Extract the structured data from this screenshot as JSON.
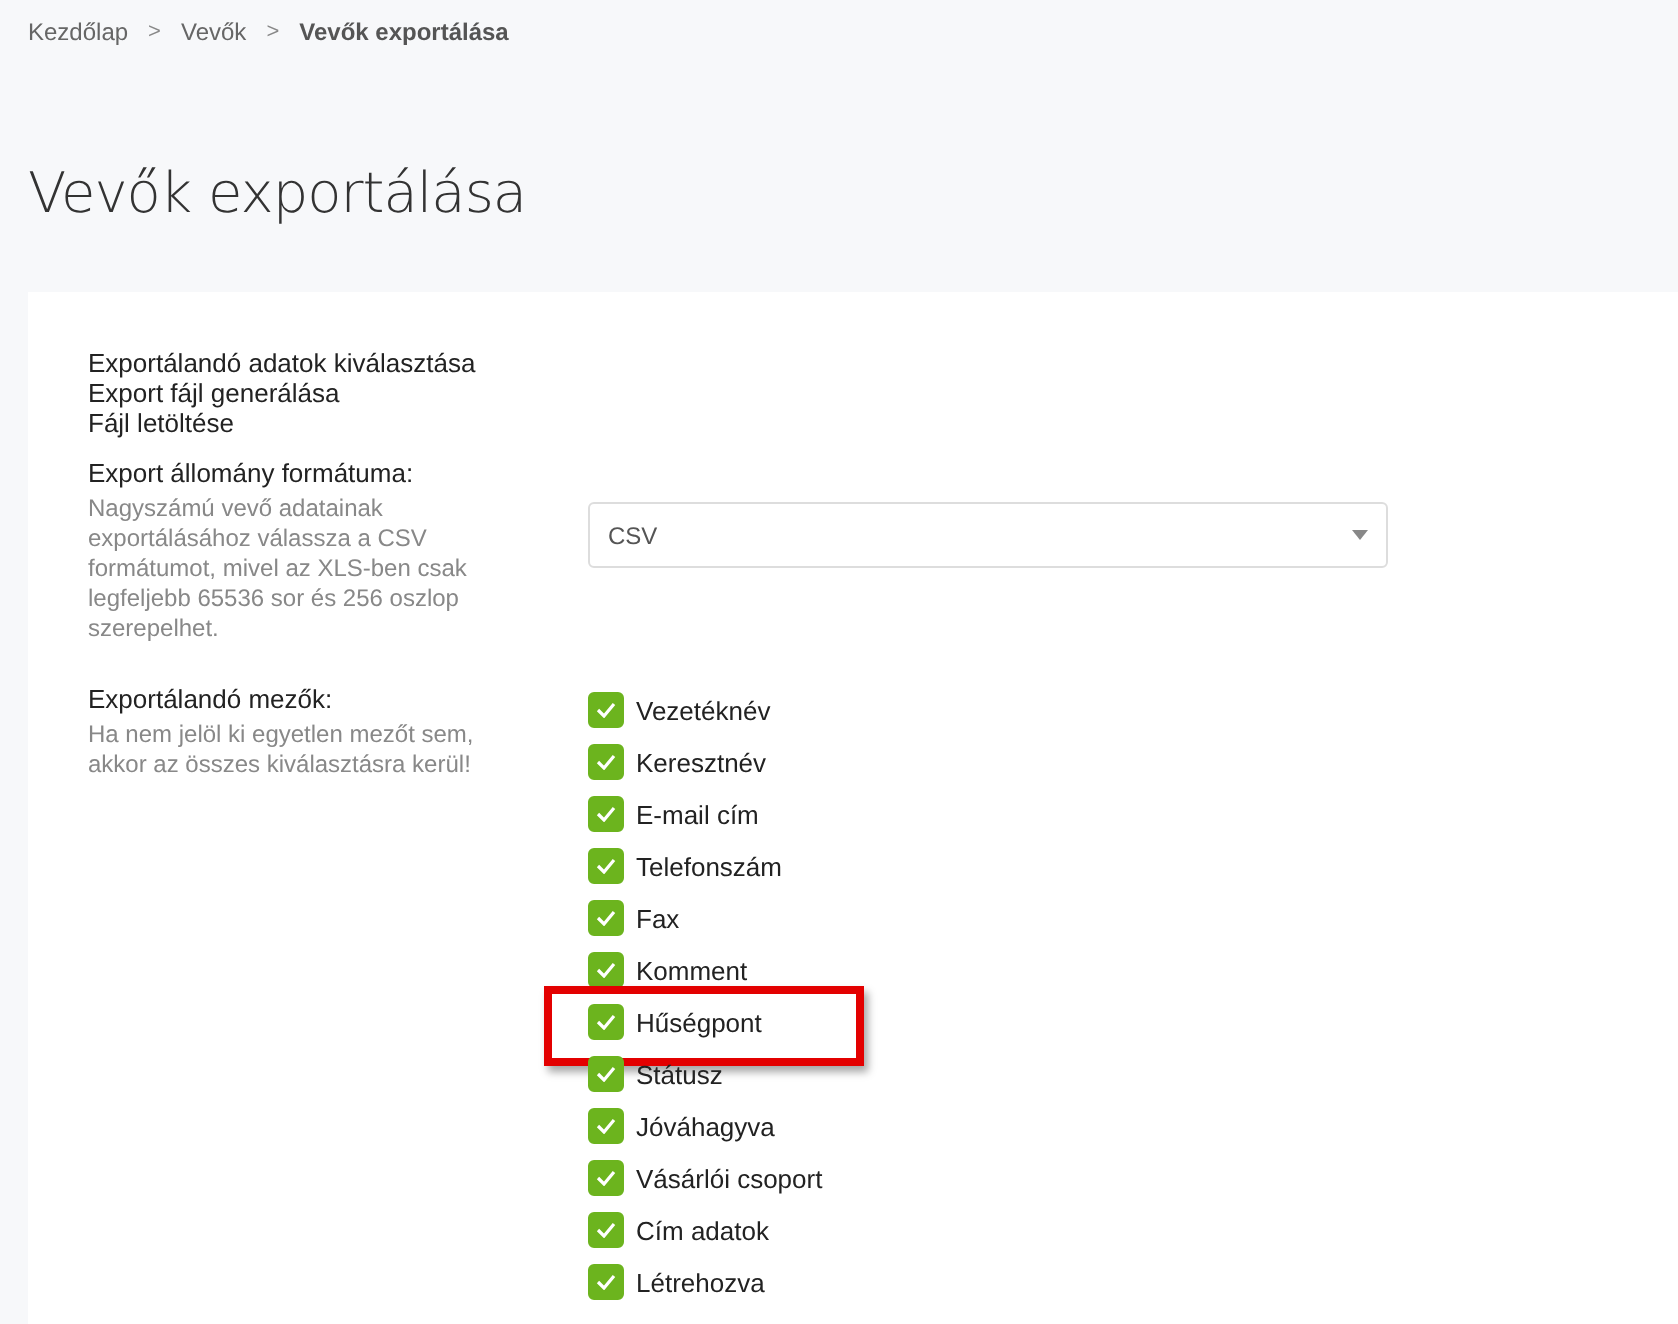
{
  "breadcrumb": [
    {
      "label": "Kezdőlap",
      "current": false
    },
    {
      "label": "Vevők",
      "current": false
    },
    {
      "label": "Vevők exportálása",
      "current": true
    }
  ],
  "breadcrumb_separator": ">",
  "title": "Vevők exportálása",
  "steps": [
    "Exportálandó adatok kiválasztása",
    "Export fájl generálása",
    "Fájl letöltése"
  ],
  "format": {
    "label": "Export állomány formátuma:",
    "hint": "Nagyszámú vevő adatainak exportálásához válassza a CSV formátumot, mivel az XLS-ben csak legfeljebb 65536 sor és 256 oszlop szerepelhet.",
    "value": "CSV"
  },
  "fields": {
    "label": "Exportálandó mezők:",
    "hint": "Ha nem jelöl ki egyetlen mezőt sem, akkor az összes kiválasztásra kerül!",
    "items": [
      {
        "label": "Vezetéknév",
        "checked": true,
        "highlighted": false
      },
      {
        "label": "Keresztnév",
        "checked": true,
        "highlighted": false
      },
      {
        "label": "E-mail cím",
        "checked": true,
        "highlighted": false
      },
      {
        "label": "Telefonszám",
        "checked": true,
        "highlighted": false
      },
      {
        "label": "Fax",
        "checked": true,
        "highlighted": false
      },
      {
        "label": "Komment",
        "checked": true,
        "highlighted": false
      },
      {
        "label": "Hűségpont",
        "checked": true,
        "highlighted": true
      },
      {
        "label": "Státusz",
        "checked": true,
        "highlighted": false
      },
      {
        "label": "Jóváhagyva",
        "checked": true,
        "highlighted": false
      },
      {
        "label": "Vásárlói csoport",
        "checked": true,
        "highlighted": false
      },
      {
        "label": "Cím adatok",
        "checked": true,
        "highlighted": false
      },
      {
        "label": "Létrehozva",
        "checked": true,
        "highlighted": false
      }
    ]
  }
}
